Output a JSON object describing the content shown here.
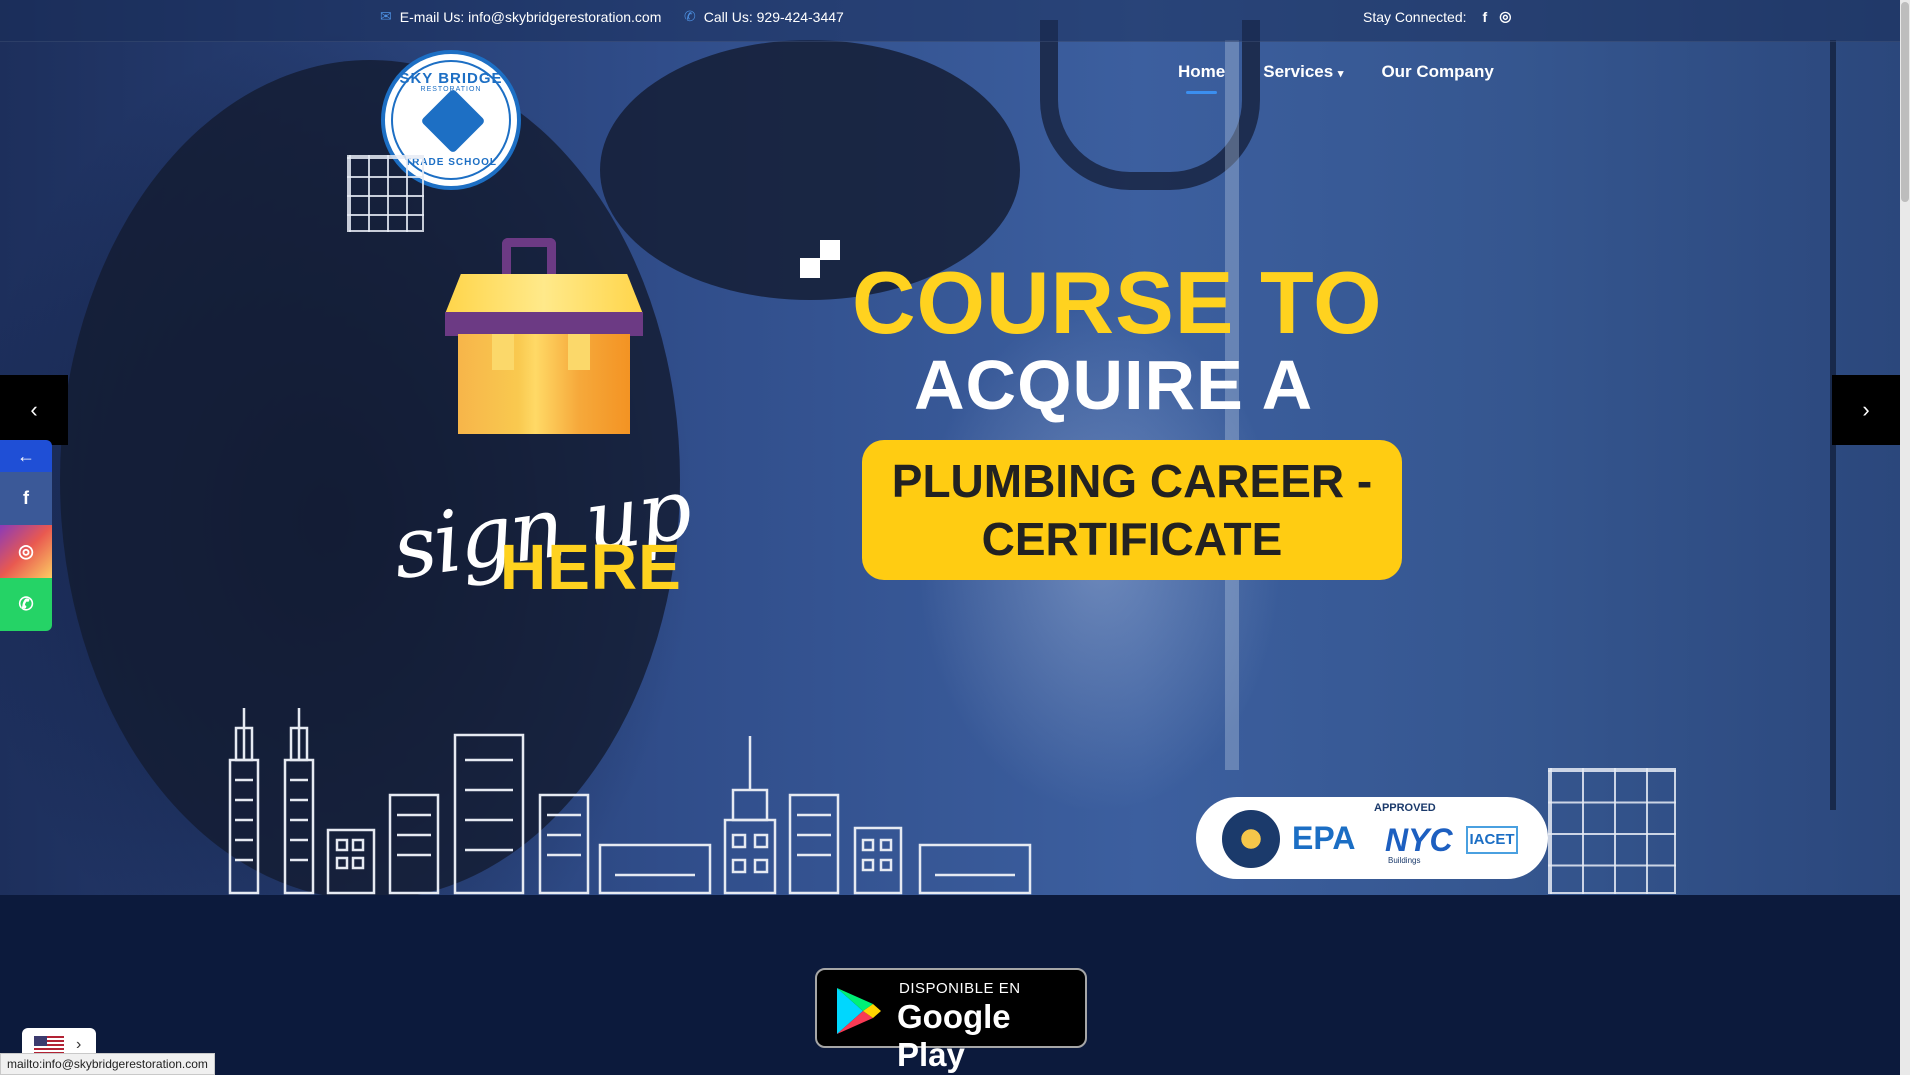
{
  "topbar": {
    "email": "E-mail Us: info@skybridgerestoration.com",
    "phone": "Call Us: 929-424-3447",
    "stay_connected": "Stay Connected:"
  },
  "logo": {
    "top_text": "SKY BRIDGE",
    "sub_text": "RESTORATION",
    "bottom_text": "TRADE SCHOOL"
  },
  "nav": {
    "items": [
      {
        "label": "Home",
        "active": true
      },
      {
        "label": "Services",
        "has_dropdown": true
      },
      {
        "label": "Our Company"
      }
    ]
  },
  "hero": {
    "signup_script": "sign up",
    "signup_bold": "HERE",
    "headline_1": "COURSE TO",
    "headline_2": "ACQUIRE A",
    "cta_box": "PLUMBING CAREER - CERTIFICATE"
  },
  "badge": {
    "label": "APPROVED",
    "epa": "EPA",
    "nyc": "NYC",
    "nyc_sub": "Buildings",
    "iacet": "IACET"
  },
  "google_play": {
    "small": "DISPONIBLE EN",
    "big": "Google Play"
  },
  "side_social": [
    "arrow-left-icon",
    "facebook-icon",
    "instagram-icon",
    "whatsapp-icon"
  ],
  "status_bar_url": "mailto:info@skybridgerestoration.com",
  "colors": {
    "accent_yellow": "#ffd21f",
    "cta_yellow": "#ffcc12",
    "accent_blue": "#3b8ff0",
    "dark_navy": "#0c1a3c",
    "facebook": "#3b5998",
    "instagram": "#d6336c",
    "whatsapp": "#25d366",
    "side_arrow": "#1f4fd6"
  }
}
